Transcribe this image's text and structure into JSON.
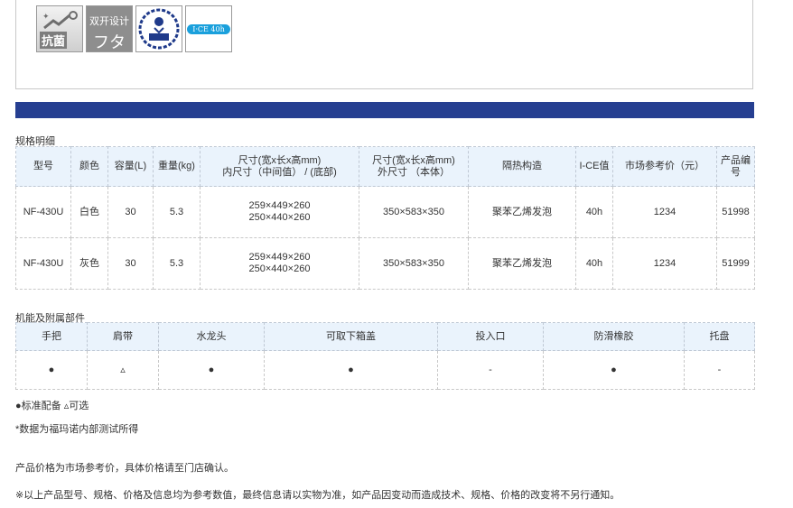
{
  "badges": [
    {
      "icon": "antibacterial-icon",
      "label": "抗菌"
    },
    {
      "icon": "double-lid-icon",
      "line1": "双开设计",
      "line2": "フタ"
    },
    {
      "icon": "heavy-load-icon"
    },
    {
      "icon": "ice-retention-icon",
      "label": "I·CE 40h"
    }
  ],
  "spec": {
    "title": "规格明细",
    "headers": [
      "型号",
      "颜色",
      "容量(L)",
      "重量(kg)",
      "尺寸(宽x长x高mm)",
      "内尺寸（中间值） / (底部)",
      "尺寸(宽x长x高mm)",
      "外尺寸 （本体）",
      "隔热构造",
      "I-CE值",
      "市场参考价（元）",
      "产品编号"
    ],
    "rows": [
      {
        "model": "NF-430U",
        "color": "白色",
        "capacity": "30",
        "weight": "5.3",
        "inner_1": "259×449×260",
        "inner_2": "250×440×260",
        "outer": "350×583×350",
        "insulation": "聚苯乙烯发泡",
        "ice": "40h",
        "price": "1234",
        "code": "51998"
      },
      {
        "model": "NF-430U",
        "color": "灰色",
        "capacity": "30",
        "weight": "5.3",
        "inner_1": "259×449×260",
        "inner_2": "250×440×260",
        "outer": "350×583×350",
        "insulation": "聚苯乙烯发泡",
        "ice": "40h",
        "price": "1234",
        "code": "51999"
      }
    ]
  },
  "features": {
    "title": "机能及附属部件",
    "headers": [
      "手把",
      "肩带",
      "水龙头",
      "可取下箱盖",
      "投入口",
      "防滑橡胶",
      "托盘"
    ],
    "values": [
      "●",
      "▵",
      "●",
      "●",
      "-",
      "●",
      "-"
    ]
  },
  "notes": {
    "legend": "●标准配备 ▵可选",
    "test": "*数据为福玛诺内部测试所得",
    "price": "产品价格为市场参考价，具体价格请至门店确认。",
    "disclaimer": "※以上产品型号、规格、价格及信息均为参考数值，最终信息请以实物为准，如产品因变动而造成技术、规格、价格的改变将不另行通知。"
  }
}
